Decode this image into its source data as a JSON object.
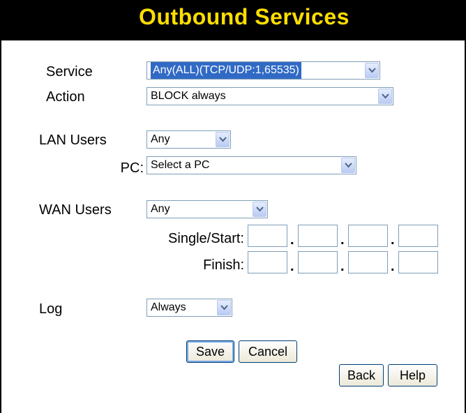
{
  "page": {
    "title": "Outbound Services"
  },
  "form": {
    "service": {
      "label": "Service",
      "value": "Any(ALL)(TCP/UDP:1,65535)"
    },
    "action": {
      "label": "Action",
      "value": "BLOCK always"
    },
    "lan_users": {
      "label": "LAN Users",
      "value": "Any"
    },
    "pc": {
      "label": "PC:",
      "value": "Select a PC"
    },
    "wan_users": {
      "label": "WAN Users",
      "value": "Any"
    },
    "single_start": {
      "label": "Single/Start:",
      "values": [
        "",
        "",
        "",
        ""
      ]
    },
    "finish": {
      "label": "Finish:",
      "values": [
        "",
        "",
        "",
        ""
      ]
    },
    "log": {
      "label": "Log",
      "value": "Always"
    },
    "ip_separator": "."
  },
  "buttons": {
    "save": "Save",
    "cancel": "Cancel",
    "back": "Back",
    "help": "Help"
  },
  "colors": {
    "title_bar": "#000000",
    "title_text": "#ffde00",
    "selection": "#316ac5"
  },
  "icons": {
    "dropdown": "chevron-down-icon"
  }
}
